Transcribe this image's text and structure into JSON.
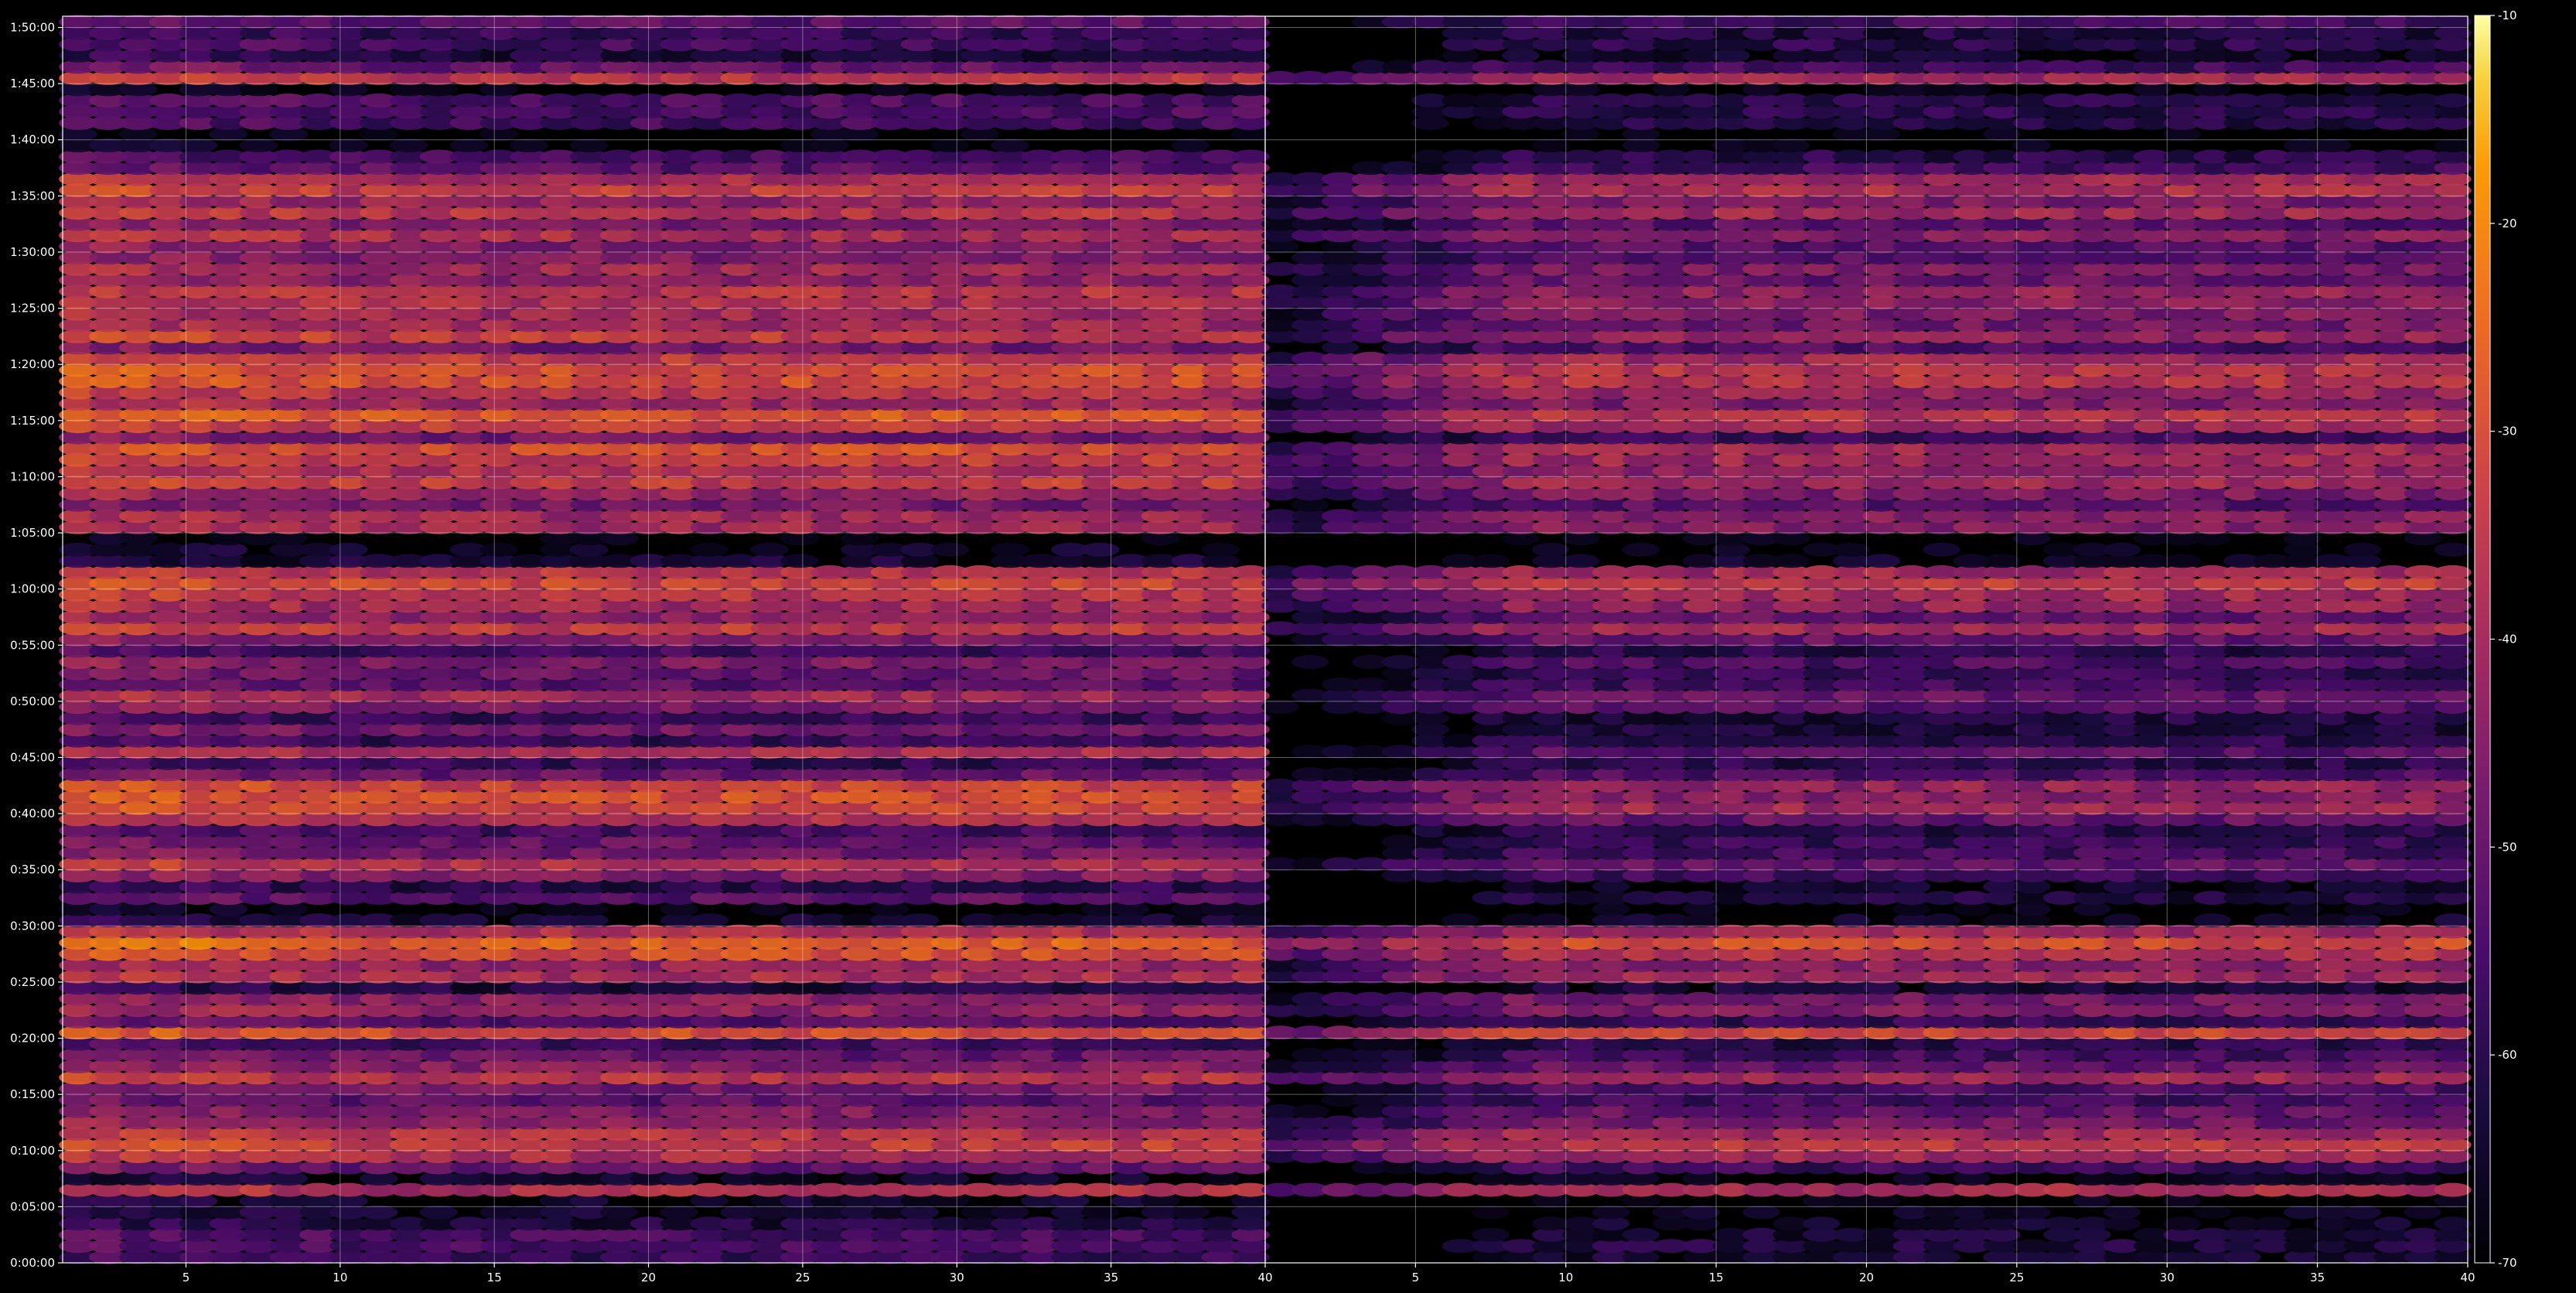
{
  "chart_data": {
    "type": "heatmap",
    "title": "",
    "xlabel": "",
    "ylabel": "",
    "grid": true,
    "colormap": "inferno",
    "background": "#000000",
    "x_tick_labels": [
      "5",
      "10",
      "15",
      "20",
      "25",
      "30",
      "35",
      "40",
      "5",
      "10",
      "15",
      "20",
      "25",
      "30",
      "35",
      "40"
    ],
    "y_tick_labels": [
      "0:00:00",
      "0:05:00",
      "0:10:00",
      "0:15:00",
      "0:20:00",
      "0:25:00",
      "0:30:00",
      "0:35:00",
      "0:40:00",
      "0:45:00",
      "0:50:00",
      "0:55:00",
      "1:00:00",
      "1:05:00",
      "1:10:00",
      "1:15:00",
      "1:20:00",
      "1:25:00",
      "1:30:00",
      "1:35:00",
      "1:40:00",
      "1:45:00",
      "1:50:00"
    ],
    "panels": [
      {
        "name": "",
        "xlim": [
          1,
          40
        ],
        "xticks": [
          5,
          10,
          15,
          20,
          25,
          30,
          35,
          40
        ]
      },
      {
        "name": "",
        "xlim": [
          0,
          40
        ],
        "xticks": [
          5,
          10,
          15,
          20,
          25,
          30,
          35,
          40
        ]
      }
    ],
    "y_unit": "minutes",
    "ylim": [
      0,
      111
    ],
    "yticks": [
      0,
      5,
      10,
      15,
      20,
      25,
      30,
      35,
      40,
      45,
      50,
      55,
      60,
      65,
      70,
      75,
      80,
      85,
      90,
      95,
      100,
      105,
      110
    ],
    "colorbar": {
      "vmin": -70,
      "vmax": -10,
      "ticks": [
        -10,
        -20,
        -30,
        -40,
        -50,
        -60,
        -70
      ],
      "tick_labels": [
        "-10",
        "-20",
        "-30",
        "-40",
        "-50",
        "-60",
        "-70"
      ]
    },
    "row_intensity": {
      "step_minutes": 1,
      "comment_free_values": true,
      "left": [
        -58,
        -55,
        -55,
        -62,
        -65,
        -66,
        -38,
        -66,
        -50,
        -38,
        -33,
        -36,
        -44,
        -46,
        -52,
        -48,
        -36,
        -44,
        -50,
        -56,
        -30,
        -52,
        -42,
        -44,
        -62,
        -38,
        -42,
        -30,
        -26,
        -38,
        -64,
        -70,
        -52,
        -60,
        -46,
        -36,
        -48,
        -50,
        -56,
        -38,
        -32,
        -30,
        -32,
        -50,
        -58,
        -38,
        -58,
        -48,
        -58,
        -46,
        -40,
        -52,
        -50,
        -46,
        -56,
        -46,
        -34,
        -44,
        -40,
        -36,
        -32,
        -36,
        -64,
        -66,
        -70,
        -40,
        -40,
        -48,
        -42,
        -34,
        -38,
        -34,
        -30,
        -48,
        -34,
        -28,
        -40,
        -36,
        -30,
        -30,
        -34,
        -48,
        -34,
        -40,
        -40,
        -38,
        -36,
        -44,
        -40,
        -46,
        -46,
        -38,
        -46,
        -36,
        -42,
        -34,
        -38,
        -52,
        -56,
        -70,
        -70,
        -56,
        -54,
        -54,
        -70,
        -36,
        -50,
        -62,
        -56,
        -58,
        -52
      ],
      "right": [
        -64,
        -62,
        -64,
        -66,
        -68,
        -70,
        -38,
        -68,
        -56,
        -40,
        -34,
        -40,
        -48,
        -50,
        -56,
        -54,
        -40,
        -50,
        -56,
        -60,
        -32,
        -58,
        -46,
        -48,
        -64,
        -40,
        -44,
        -36,
        -30,
        -40,
        -66,
        -70,
        -62,
        -66,
        -56,
        -50,
        -56,
        -58,
        -60,
        -50,
        -40,
        -44,
        -42,
        -54,
        -60,
        -52,
        -60,
        -62,
        -62,
        -52,
        -50,
        -56,
        -58,
        -54,
        -60,
        -50,
        -40,
        -50,
        -42,
        -40,
        -34,
        -40,
        -66,
        -68,
        -70,
        -44,
        -44,
        -52,
        -46,
        -40,
        -44,
        -40,
        -40,
        -56,
        -40,
        -36,
        -46,
        -42,
        -36,
        -36,
        -40,
        -54,
        -42,
        -48,
        -46,
        -44,
        -42,
        -50,
        -46,
        -52,
        -52,
        -44,
        -52,
        -40,
        -46,
        -38,
        -40,
        -56,
        -60,
        -70,
        -70,
        -62,
        -60,
        -60,
        -70,
        -40,
        -56,
        -66,
        -60,
        -62,
        -56
      ]
    }
  }
}
